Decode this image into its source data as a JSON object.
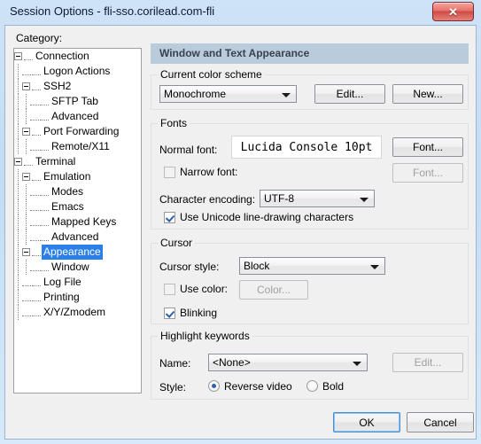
{
  "window": {
    "title": "Session Options - fli-sso.corilead.com-fli",
    "close_icon": "close-icon",
    "close_glyph": "✕"
  },
  "sidebar": {
    "label": "Category:",
    "items": [
      {
        "label": "Connection",
        "depth": 0,
        "expander": true,
        "selected": false
      },
      {
        "label": "Logon Actions",
        "depth": 1,
        "expander": false,
        "selected": false
      },
      {
        "label": "SSH2",
        "depth": 1,
        "expander": true,
        "selected": false
      },
      {
        "label": "SFTP Tab",
        "depth": 2,
        "expander": false,
        "selected": false
      },
      {
        "label": "Advanced",
        "depth": 2,
        "expander": false,
        "selected": false
      },
      {
        "label": "Port Forwarding",
        "depth": 1,
        "expander": true,
        "selected": false
      },
      {
        "label": "Remote/X11",
        "depth": 2,
        "expander": false,
        "selected": false
      },
      {
        "label": "Terminal",
        "depth": 0,
        "expander": true,
        "selected": false
      },
      {
        "label": "Emulation",
        "depth": 1,
        "expander": true,
        "selected": false
      },
      {
        "label": "Modes",
        "depth": 2,
        "expander": false,
        "selected": false
      },
      {
        "label": "Emacs",
        "depth": 2,
        "expander": false,
        "selected": false
      },
      {
        "label": "Mapped Keys",
        "depth": 2,
        "expander": false,
        "selected": false
      },
      {
        "label": "Advanced",
        "depth": 2,
        "expander": false,
        "selected": false
      },
      {
        "label": "Appearance",
        "depth": 1,
        "expander": true,
        "selected": true
      },
      {
        "label": "Window",
        "depth": 2,
        "expander": false,
        "selected": false
      },
      {
        "label": "Log File",
        "depth": 1,
        "expander": false,
        "selected": false
      },
      {
        "label": "Printing",
        "depth": 1,
        "expander": false,
        "selected": false
      },
      {
        "label": "X/Y/Zmodem",
        "depth": 1,
        "expander": false,
        "selected": false
      }
    ]
  },
  "pane": {
    "header": "Window and Text Appearance",
    "header_color": "#bacbdb",
    "color_scheme": {
      "legend": "Current color scheme",
      "value": "Monochrome",
      "edit_label": "Edit...",
      "new_label": "New..."
    },
    "fonts": {
      "legend": "Fonts",
      "normal_font_label": "Normal font:",
      "normal_font_value": "Lucida Console 10pt",
      "normal_font_button": "Font...",
      "narrow_font_label": "Narrow font:",
      "narrow_font_checked": false,
      "narrow_font_button": "Font...",
      "encoding_label": "Character encoding:",
      "encoding_value": "UTF-8",
      "unicode_label": "Use Unicode line-drawing characters",
      "unicode_checked": true
    },
    "cursor": {
      "legend": "Cursor",
      "style_label": "Cursor style:",
      "style_value": "Block",
      "use_color_label": "Use color:",
      "use_color_checked": false,
      "color_button": "Color...",
      "blinking_label": "Blinking",
      "blinking_checked": true
    },
    "highlight": {
      "legend": "Highlight keywords",
      "name_label": "Name:",
      "name_value": "<None>",
      "edit_label": "Edit...",
      "style_label": "Style:",
      "reverse_video_label": "Reverse video",
      "reverse_video_selected": true,
      "bold_label": "Bold",
      "bold_selected": false
    }
  },
  "footer": {
    "ok_label": "OK",
    "cancel_label": "Cancel"
  }
}
